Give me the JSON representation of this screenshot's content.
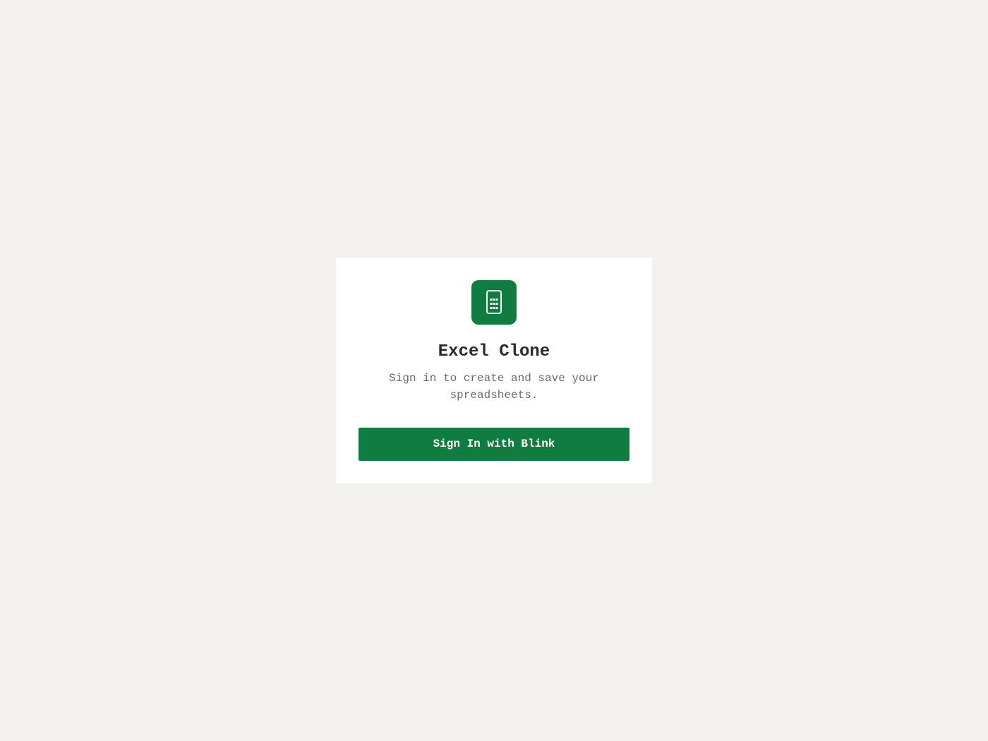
{
  "login": {
    "app_title": "Excel Clone",
    "subtitle": "Sign in to create and save your spreadsheets.",
    "signin_button_label": "Sign In with Blink",
    "logo_icon": "calculator-icon"
  },
  "colors": {
    "background": "#f3f2f1",
    "card": "#ffffff",
    "accent": "#107c41",
    "title_text": "#2b2b2b",
    "subtitle_text": "#6b6b6b"
  }
}
